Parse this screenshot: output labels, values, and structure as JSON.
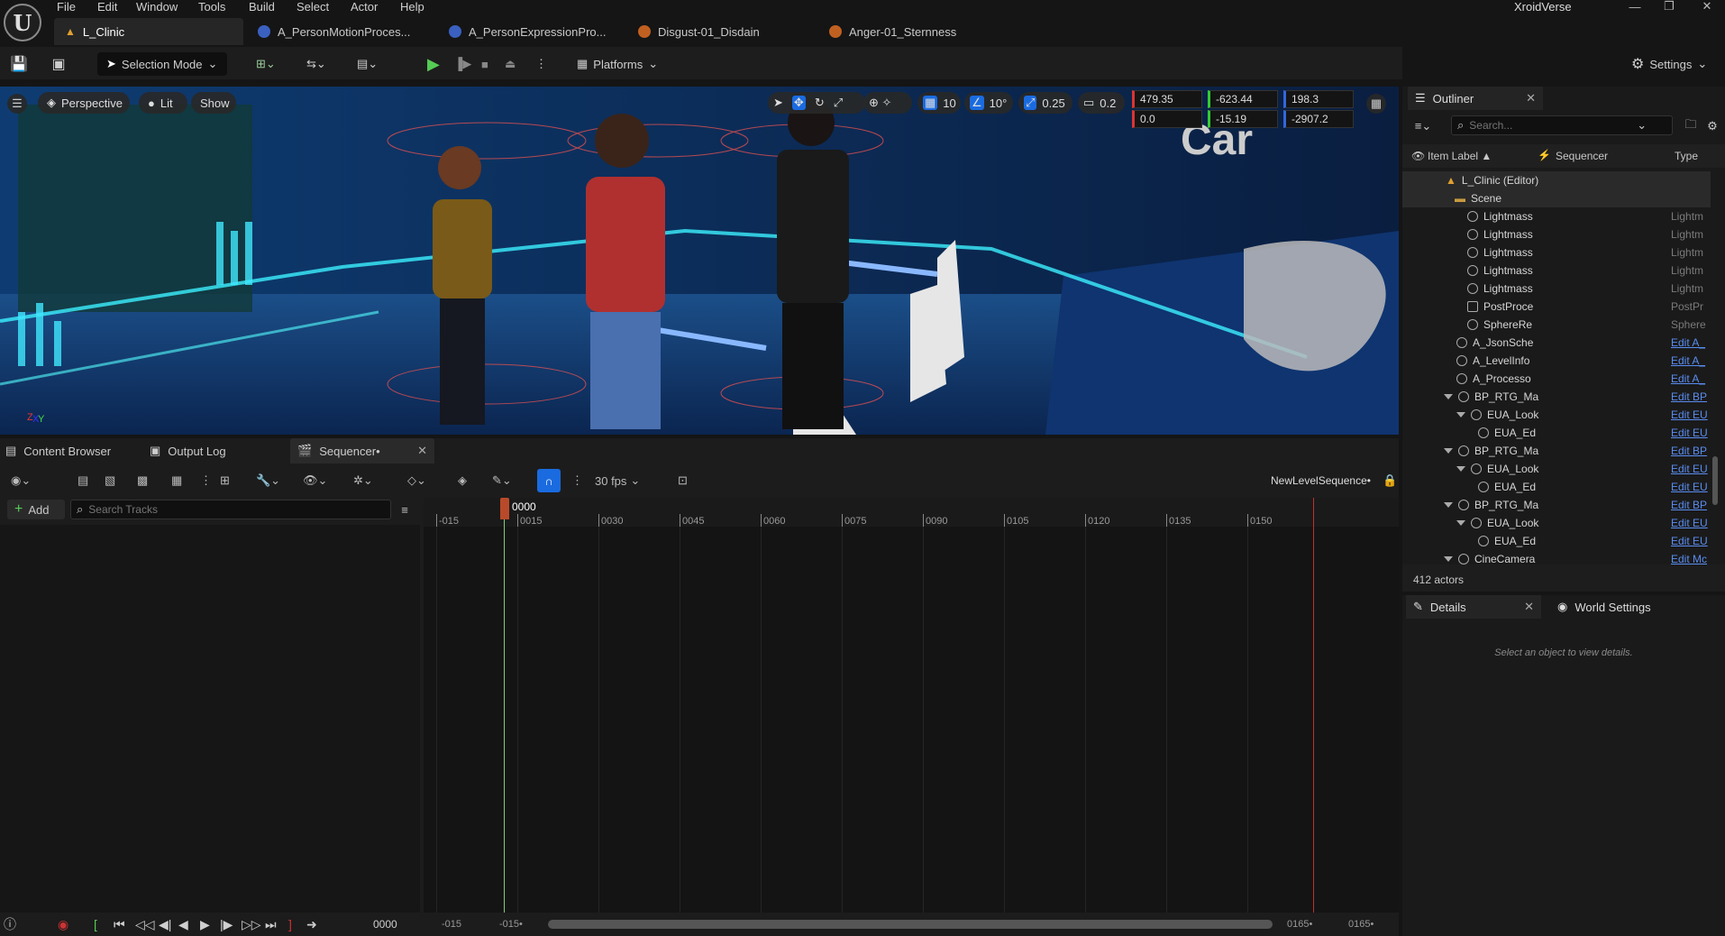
{
  "app": {
    "workspace": "XroidVerse",
    "logo": "unreal-logo"
  },
  "menu": [
    "File",
    "Edit",
    "Window",
    "Tools",
    "Build",
    "Select",
    "Actor",
    "Help"
  ],
  "doc_tabs": [
    {
      "label": "L_Clinic",
      "active": true
    },
    {
      "label": "A_PersonMotionProces..."
    },
    {
      "label": "A_PersonExpressionPro..."
    },
    {
      "label": "Disgust-01_Disdain"
    },
    {
      "label": "Anger-01_Sternness"
    }
  ],
  "toolbar": {
    "selection_mode": "Selection Mode",
    "platforms": "Platforms",
    "settings": "Settings"
  },
  "viewport": {
    "perspective": "Perspective",
    "lit": "Lit",
    "show": "Show",
    "grid_snap": "10",
    "rot_snap": "10°",
    "scale_snap": "0.25",
    "cam_speed": "0.2",
    "location": [
      "479.35",
      "-623.44",
      "198.3"
    ],
    "rotation": [
      "0.0",
      "-15.19",
      "-2907.2"
    ]
  },
  "outliner": {
    "title": "Outliner",
    "search_placeholder": "Search...",
    "columns": [
      "Item Label ▲",
      "Sequencer",
      "Type"
    ],
    "rows": [
      {
        "label": "L_Clinic (Editor)",
        "type": ""
      },
      {
        "label": "Scene",
        "type": ""
      },
      {
        "label": "Lightmass",
        "type": "Lightm"
      },
      {
        "label": "Lightmass",
        "type": "Lightm"
      },
      {
        "label": "Lightmass",
        "type": "Lightm"
      },
      {
        "label": "Lightmass",
        "type": "Lightm"
      },
      {
        "label": "Lightmass",
        "type": "Lightm"
      },
      {
        "label": "PostProce",
        "type": "PostPr"
      },
      {
        "label": "SphereRe",
        "type": "Sphere"
      },
      {
        "label": "A_JsonSche",
        "type": "Edit A_"
      },
      {
        "label": "A_LevelInfo",
        "type": "Edit A_"
      },
      {
        "label": "A_Processo",
        "type": "Edit A_"
      },
      {
        "label": "BP_RTG_Ma",
        "type": "Edit BP"
      },
      {
        "label": "EUA_Look",
        "type": "Edit EU"
      },
      {
        "label": "EUA_Ed",
        "type": "Edit EU"
      },
      {
        "label": "BP_RTG_Ma",
        "type": "Edit BP"
      },
      {
        "label": "EUA_Look",
        "type": "Edit EU"
      },
      {
        "label": "EUA_Ed",
        "type": "Edit EU"
      },
      {
        "label": "BP_RTG_Ma",
        "type": "Edit BP"
      },
      {
        "label": "EUA_Look",
        "type": "Edit EU"
      },
      {
        "label": "EUA_Ed",
        "type": "Edit EU"
      },
      {
        "label": "CineCamera",
        "type": "Edit Mc"
      }
    ],
    "actor_count": "412 actors"
  },
  "details": {
    "tab": "Details",
    "world_tab": "World Settings",
    "empty": "Select an object to view details."
  },
  "bottom_tabs": [
    "Content Browser",
    "Output Log",
    "Sequencer•"
  ],
  "sequencer": {
    "fps": "30 fps",
    "sequence_name": "NewLevelSequence•",
    "add": "Add",
    "search_placeholder": "Search Tracks",
    "playhead": "0000",
    "ticks": [
      "-015",
      "0015",
      "0030",
      "0045",
      "0060",
      "0075",
      "0090",
      "0105",
      "0120",
      "0135",
      "0150"
    ],
    "current_frame": "0000",
    "range": [
      "-015",
      "-015•",
      "0165•",
      "0165•"
    ]
  }
}
